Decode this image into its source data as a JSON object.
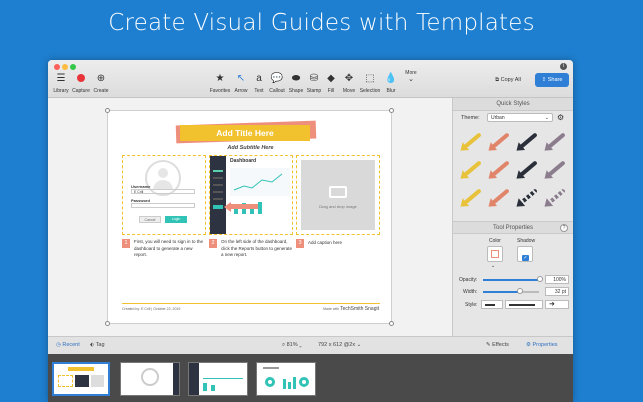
{
  "hero": {
    "title": "Create Visual Guides with Templates"
  },
  "toolbar": {
    "left": [
      {
        "label": "Library",
        "icon": "library-icon"
      },
      {
        "label": "Capture",
        "icon": "capture-icon"
      },
      {
        "label": "Create",
        "icon": "create-icon"
      }
    ],
    "tools": [
      {
        "label": "Favorites",
        "icon": "star-icon"
      },
      {
        "label": "Arrow",
        "icon": "arrow-icon"
      },
      {
        "label": "Text",
        "icon": "text-icon"
      },
      {
        "label": "Callout",
        "icon": "callout-icon"
      },
      {
        "label": "Shape",
        "icon": "shape-icon"
      },
      {
        "label": "Stamp",
        "icon": "stamp-icon"
      },
      {
        "label": "Fill",
        "icon": "fill-icon"
      },
      {
        "label": "Move",
        "icon": "move-icon"
      },
      {
        "label": "Selection",
        "icon": "selection-icon"
      },
      {
        "label": "Blur",
        "icon": "blur-icon"
      },
      {
        "label": "More",
        "icon": "more-icon"
      }
    ],
    "copy_all": "Copy All",
    "share": "Share",
    "accent": "#2f7fd6"
  },
  "document": {
    "title": "Add Title Here",
    "subtitle": "Add Subtitle Here",
    "title_band_color": "#f2c12e",
    "login": {
      "username_label": "Username",
      "username_value": "E Crill",
      "password_label": "Password",
      "cancel": "Cancel",
      "login": "Login"
    },
    "dashboard_title": "Dashboard",
    "drop_text": "Drag and drop image",
    "steps": [
      {
        "num": "1",
        "text": "First, you will need to sign in to the dashboard to generate a new report."
      },
      {
        "num": "2",
        "text": "On the left side of the dashboard, click the Reports button to generate a new report."
      },
      {
        "num": "3",
        "text": "Add caption here"
      }
    ],
    "footer_left": "Created by: E Crill | October 22, 2019",
    "footer_right_prefix": "Made with",
    "footer_right_brand": "TechSmith Snagit"
  },
  "panel": {
    "quick_styles": "Quick Styles",
    "theme_label": "Theme:",
    "theme_value": "Urban",
    "tool_properties": "Tool Properties",
    "color_label": "Color",
    "shadow_label": "Shadow",
    "opacity_label": "Opacity:",
    "opacity_value": "100%",
    "width_label": "Width:",
    "width_value": "32 pt",
    "style_label": "Style:",
    "arrow_colors": [
      "#e8c23a",
      "#e0846a",
      "#2a2f3a",
      "#8c7d8e",
      "#e8c23a",
      "#e0846a",
      "#2a2f3a",
      "#8c7d8e",
      "#e8c23a",
      "#e0846a",
      "#2a2f3a",
      "#8c7d8e"
    ]
  },
  "bottom": {
    "recent": "Recent",
    "tag": "Tag",
    "zoom": "81%",
    "dimensions": "792 x 612 @2x",
    "effects": "Effects",
    "properties": "Properties"
  }
}
